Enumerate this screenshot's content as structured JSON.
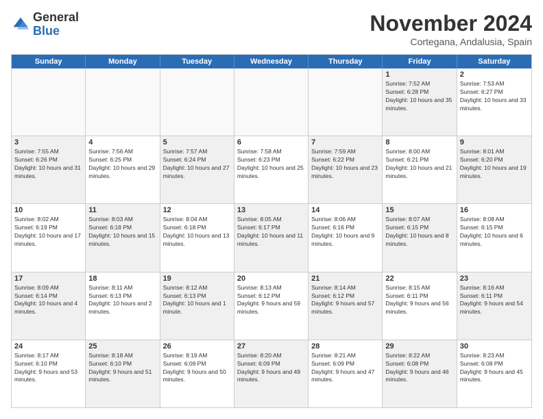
{
  "header": {
    "logo_general": "General",
    "logo_blue": "Blue",
    "month_title": "November 2024",
    "location": "Cortegana, Andalusia, Spain"
  },
  "weekdays": [
    "Sunday",
    "Monday",
    "Tuesday",
    "Wednesday",
    "Thursday",
    "Friday",
    "Saturday"
  ],
  "rows": [
    [
      {
        "day": "",
        "info": "",
        "empty": true
      },
      {
        "day": "",
        "info": "",
        "empty": true
      },
      {
        "day": "",
        "info": "",
        "empty": true
      },
      {
        "day": "",
        "info": "",
        "empty": true
      },
      {
        "day": "",
        "info": "",
        "empty": true
      },
      {
        "day": "1",
        "info": "Sunrise: 7:52 AM\nSunset: 6:28 PM\nDaylight: 10 hours and 35 minutes.",
        "shaded": true
      },
      {
        "day": "2",
        "info": "Sunrise: 7:53 AM\nSunset: 6:27 PM\nDaylight: 10 hours and 33 minutes.",
        "shaded": false
      }
    ],
    [
      {
        "day": "3",
        "info": "Sunrise: 7:55 AM\nSunset: 6:26 PM\nDaylight: 10 hours and 31 minutes.",
        "shaded": true
      },
      {
        "day": "4",
        "info": "Sunrise: 7:56 AM\nSunset: 6:25 PM\nDaylight: 10 hours and 29 minutes.",
        "shaded": false
      },
      {
        "day": "5",
        "info": "Sunrise: 7:57 AM\nSunset: 6:24 PM\nDaylight: 10 hours and 27 minutes.",
        "shaded": true
      },
      {
        "day": "6",
        "info": "Sunrise: 7:58 AM\nSunset: 6:23 PM\nDaylight: 10 hours and 25 minutes.",
        "shaded": false
      },
      {
        "day": "7",
        "info": "Sunrise: 7:59 AM\nSunset: 6:22 PM\nDaylight: 10 hours and 23 minutes.",
        "shaded": true
      },
      {
        "day": "8",
        "info": "Sunrise: 8:00 AM\nSunset: 6:21 PM\nDaylight: 10 hours and 21 minutes.",
        "shaded": false
      },
      {
        "day": "9",
        "info": "Sunrise: 8:01 AM\nSunset: 6:20 PM\nDaylight: 10 hours and 19 minutes.",
        "shaded": true
      }
    ],
    [
      {
        "day": "10",
        "info": "Sunrise: 8:02 AM\nSunset: 6:19 PM\nDaylight: 10 hours and 17 minutes.",
        "shaded": false
      },
      {
        "day": "11",
        "info": "Sunrise: 8:03 AM\nSunset: 6:18 PM\nDaylight: 10 hours and 15 minutes.",
        "shaded": true
      },
      {
        "day": "12",
        "info": "Sunrise: 8:04 AM\nSunset: 6:18 PM\nDaylight: 10 hours and 13 minutes.",
        "shaded": false
      },
      {
        "day": "13",
        "info": "Sunrise: 8:05 AM\nSunset: 6:17 PM\nDaylight: 10 hours and 11 minutes.",
        "shaded": true
      },
      {
        "day": "14",
        "info": "Sunrise: 8:06 AM\nSunset: 6:16 PM\nDaylight: 10 hours and 9 minutes.",
        "shaded": false
      },
      {
        "day": "15",
        "info": "Sunrise: 8:07 AM\nSunset: 6:15 PM\nDaylight: 10 hours and 8 minutes.",
        "shaded": true
      },
      {
        "day": "16",
        "info": "Sunrise: 8:08 AM\nSunset: 6:15 PM\nDaylight: 10 hours and 6 minutes.",
        "shaded": false
      }
    ],
    [
      {
        "day": "17",
        "info": "Sunrise: 8:09 AM\nSunset: 6:14 PM\nDaylight: 10 hours and 4 minutes.",
        "shaded": true
      },
      {
        "day": "18",
        "info": "Sunrise: 8:11 AM\nSunset: 6:13 PM\nDaylight: 10 hours and 2 minutes.",
        "shaded": false
      },
      {
        "day": "19",
        "info": "Sunrise: 8:12 AM\nSunset: 6:13 PM\nDaylight: 10 hours and 1 minute.",
        "shaded": true
      },
      {
        "day": "20",
        "info": "Sunrise: 8:13 AM\nSunset: 6:12 PM\nDaylight: 9 hours and 59 minutes.",
        "shaded": false
      },
      {
        "day": "21",
        "info": "Sunrise: 8:14 AM\nSunset: 6:12 PM\nDaylight: 9 hours and 57 minutes.",
        "shaded": true
      },
      {
        "day": "22",
        "info": "Sunrise: 8:15 AM\nSunset: 6:11 PM\nDaylight: 9 hours and 56 minutes.",
        "shaded": false
      },
      {
        "day": "23",
        "info": "Sunrise: 8:16 AM\nSunset: 6:11 PM\nDaylight: 9 hours and 54 minutes.",
        "shaded": true
      }
    ],
    [
      {
        "day": "24",
        "info": "Sunrise: 8:17 AM\nSunset: 6:10 PM\nDaylight: 9 hours and 53 minutes.",
        "shaded": false
      },
      {
        "day": "25",
        "info": "Sunrise: 8:18 AM\nSunset: 6:10 PM\nDaylight: 9 hours and 51 minutes.",
        "shaded": true
      },
      {
        "day": "26",
        "info": "Sunrise: 8:19 AM\nSunset: 6:09 PM\nDaylight: 9 hours and 50 minutes.",
        "shaded": false
      },
      {
        "day": "27",
        "info": "Sunrise: 8:20 AM\nSunset: 6:09 PM\nDaylight: 9 hours and 49 minutes.",
        "shaded": true
      },
      {
        "day": "28",
        "info": "Sunrise: 8:21 AM\nSunset: 6:09 PM\nDaylight: 9 hours and 47 minutes.",
        "shaded": false
      },
      {
        "day": "29",
        "info": "Sunrise: 8:22 AM\nSunset: 6:08 PM\nDaylight: 9 hours and 46 minutes.",
        "shaded": true
      },
      {
        "day": "30",
        "info": "Sunrise: 8:23 AM\nSunset: 6:08 PM\nDaylight: 9 hours and 45 minutes.",
        "shaded": false
      }
    ]
  ]
}
